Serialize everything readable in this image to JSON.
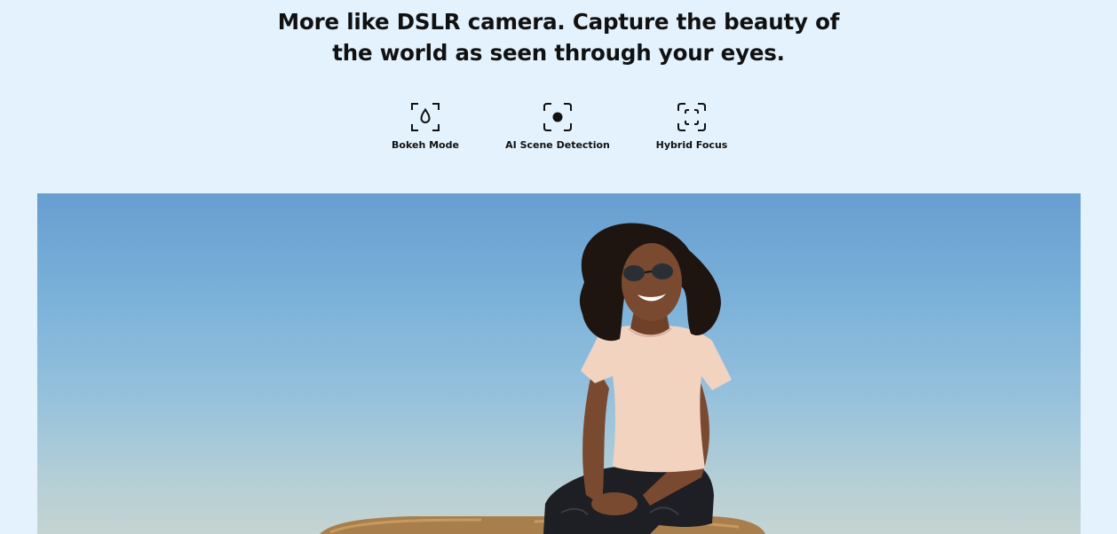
{
  "headline": {
    "line1": "More like DSLR camera. Capture the beauty of",
    "line2": "the world as seen through your eyes."
  },
  "features": [
    {
      "label": "Bokeh Mode",
      "icon": "bokeh-icon"
    },
    {
      "label": "AI Scene Detection",
      "icon": "ai-scene-icon"
    },
    {
      "label": "Hybrid Focus",
      "icon": "hybrid-focus-icon"
    }
  ],
  "hero": {
    "alt": "photo-woman-sitting-on-hay-bale"
  },
  "colors": {
    "background": "#e3f2fd",
    "text": "#111111",
    "sky_top": "#679ed0",
    "sky_bottom": "#c4d4d2"
  }
}
